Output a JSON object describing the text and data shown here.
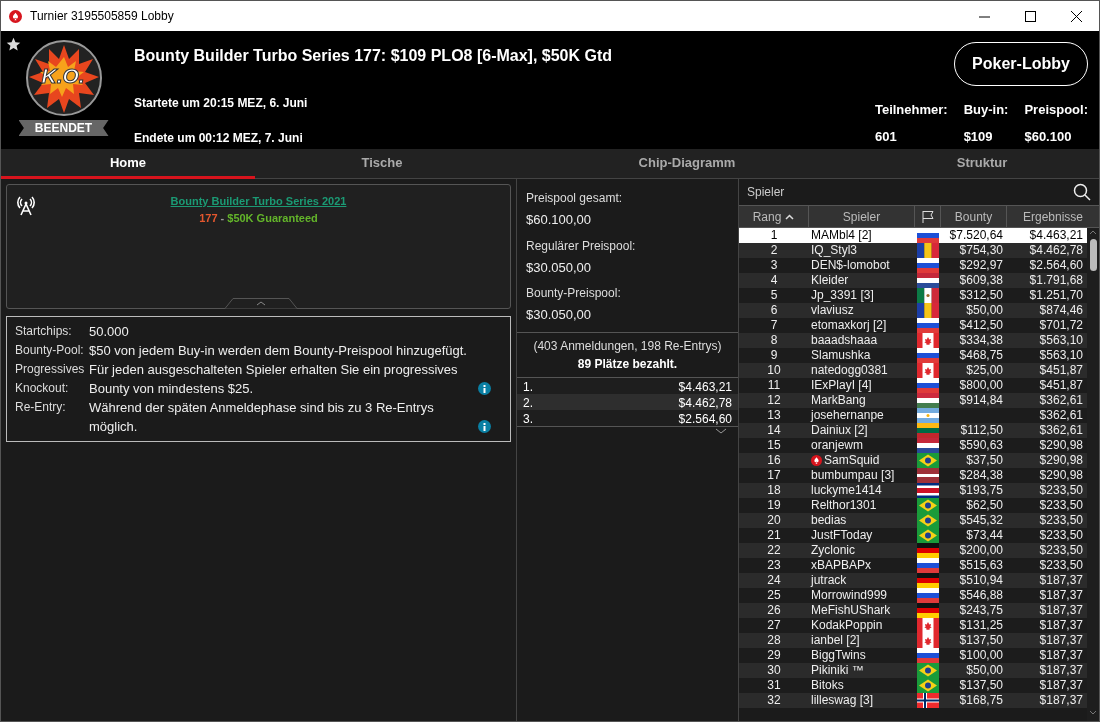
{
  "window": {
    "title": "Turnier 3195505859 Lobby"
  },
  "header": {
    "badge_text": "K.O.",
    "status": "BEENDET",
    "title": "Bounty Builder Turbo Series 177: $109 PLO8 [6-Max], $50K Gtd",
    "started": "Startete um 20:15 MEZ, 6. Juni",
    "ended": "Endete um 00:12 MEZ, 7. Juni",
    "lobby_button": "Poker-Lobby",
    "stats": [
      {
        "label": "Teilnehmer:",
        "value": "601"
      },
      {
        "label": "Buy-in:",
        "value": "$109"
      },
      {
        "label": "Preispool:",
        "value": "$60.100"
      }
    ]
  },
  "tabs": [
    {
      "label": "Home",
      "selected": true
    },
    {
      "label": "Tische",
      "selected": false
    },
    {
      "label": "Chip-Diagramm",
      "selected": false
    },
    {
      "label": "Struktur",
      "selected": false
    }
  ],
  "banner": {
    "link": "Bounty Builder Turbo Series 2021",
    "number": "177",
    "separator": "-",
    "guarantee": "$50K Guaranteed"
  },
  "details": [
    {
      "label": "Startchips:",
      "value": "50.000",
      "info": false
    },
    {
      "label": "Bounty-Pool:",
      "value": "$50 von jedem Buy-in werden dem Bounty-Preispool hinzugefügt.",
      "info": false
    },
    {
      "label": "Progressives Knockout:",
      "value": "Für jeden ausgeschalteten Spieler erhalten Sie ein progressives Bounty von mindestens $25.",
      "info": true
    },
    {
      "label": "Re-Entry:",
      "value": "Während der späten Anmeldephase sind bis zu 3 Re-Entrys möglich.",
      "info": true
    }
  ],
  "prizepool": [
    {
      "label": "Preispool gesamt:",
      "value": "$60.100,00"
    },
    {
      "label": "Regulärer Preispool:",
      "value": "$30.050,00"
    },
    {
      "label": "Bounty-Preispool:",
      "value": "$30.050,00"
    }
  ],
  "entries_note": "(403 Anmeldungen, 198 Re-Entrys)",
  "paid_note": "89 Plätze bezahlt.",
  "payouts": [
    {
      "place": "1.",
      "amount": "$4.463,21"
    },
    {
      "place": "2.",
      "amount": "$4.462,78"
    },
    {
      "place": "3.",
      "amount": "$2.564,60"
    }
  ],
  "players": {
    "search_placeholder": "Spieler",
    "columns": [
      "Rang",
      "Spieler",
      "Bounty",
      "Ergebnisse"
    ],
    "rows": [
      {
        "rank": "1",
        "name": "MAMbl4 [2]",
        "kind": "ru",
        "bounty": "$7.520,64",
        "result": "$4.463,21",
        "selected": true,
        "pro": false
      },
      {
        "rank": "2",
        "name": "IQ_Styl3",
        "kind": "ro",
        "bounty": "$754,30",
        "result": "$4.462,78",
        "selected": false,
        "pro": false
      },
      {
        "rank": "3",
        "name": "DEN$-lomobot",
        "kind": "ru",
        "bounty": "$292,97",
        "result": "$2.564,60",
        "selected": false,
        "pro": false
      },
      {
        "rank": "4",
        "name": "Kleider",
        "kind": "nl",
        "bounty": "$609,38",
        "result": "$1.791,68",
        "selected": false,
        "pro": false
      },
      {
        "rank": "5",
        "name": "Jp_3391 [3]",
        "kind": "mx",
        "bounty": "$312,50",
        "result": "$1.251,70",
        "selected": false,
        "pro": false
      },
      {
        "rank": "6",
        "name": "vlaviusz",
        "kind": "ro",
        "bounty": "$50,00",
        "result": "$874,46",
        "selected": false,
        "pro": false
      },
      {
        "rank": "7",
        "name": "etomaxkorj [2]",
        "kind": "ru",
        "bounty": "$412,50",
        "result": "$701,72",
        "selected": false,
        "pro": false
      },
      {
        "rank": "8",
        "name": "baaadshaaa",
        "kind": "ca",
        "bounty": "$334,38",
        "result": "$563,10",
        "selected": false,
        "pro": false
      },
      {
        "rank": "9",
        "name": "Slamushka",
        "kind": "ru",
        "bounty": "$468,75",
        "result": "$563,10",
        "selected": false,
        "pro": false
      },
      {
        "rank": "10",
        "name": "natedogg0381",
        "kind": "ca",
        "bounty": "$25,00",
        "result": "$451,87",
        "selected": false,
        "pro": false
      },
      {
        "rank": "11",
        "name": "IExPlayI [4]",
        "kind": "ru",
        "bounty": "$800,00",
        "result": "$451,87",
        "selected": false,
        "pro": false
      },
      {
        "rank": "12",
        "name": "MarkBang",
        "kind": "hu",
        "bounty": "$914,84",
        "result": "$362,61",
        "selected": false,
        "pro": false
      },
      {
        "rank": "13",
        "name": "josehernanpe",
        "kind": "ar",
        "result": "$362,61",
        "selected": false,
        "pro": false
      },
      {
        "rank": "14",
        "name": "Dainiux [2]",
        "kind": "lt",
        "bounty": "$112,50",
        "result": "$362,61",
        "selected": false,
        "pro": false
      },
      {
        "rank": "15",
        "name": "oranjewm",
        "kind": "nl",
        "bounty": "$590,63",
        "result": "$290,98",
        "selected": false,
        "pro": false
      },
      {
        "rank": "16",
        "name": "SamSquid",
        "kind": "br",
        "bounty": "$37,50",
        "result": "$290,98",
        "selected": false,
        "pro": true
      },
      {
        "rank": "17",
        "name": "bumbumpau [3]",
        "kind": "lv",
        "bounty": "$284,38",
        "result": "$290,98",
        "selected": false,
        "pro": false
      },
      {
        "rank": "18",
        "name": "luckyme1414",
        "kind": "cr",
        "bounty": "$193,75",
        "result": "$233,50",
        "selected": false,
        "pro": false
      },
      {
        "rank": "19",
        "name": "Relthor1301",
        "kind": "br",
        "bounty": "$62,50",
        "result": "$233,50",
        "selected": false,
        "pro": false
      },
      {
        "rank": "20",
        "name": "bedias",
        "kind": "br",
        "bounty": "$545,32",
        "result": "$233,50",
        "selected": false,
        "pro": false
      },
      {
        "rank": "21",
        "name": "JustFToday",
        "kind": "br",
        "bounty": "$73,44",
        "result": "$233,50",
        "selected": false,
        "pro": false
      },
      {
        "rank": "22",
        "name": "Zyclonic",
        "kind": "de",
        "bounty": "$200,00",
        "result": "$233,50",
        "selected": false,
        "pro": false
      },
      {
        "rank": "23",
        "name": "xBAPBAPx",
        "kind": "ru",
        "bounty": "$515,63",
        "result": "$233,50",
        "selected": false,
        "pro": false
      },
      {
        "rank": "24",
        "name": "jutrack",
        "kind": "de",
        "bounty": "$510,94",
        "result": "$187,37",
        "selected": false,
        "pro": false
      },
      {
        "rank": "25",
        "name": "Morrowind999",
        "kind": "ru",
        "bounty": "$546,88",
        "result": "$187,37",
        "selected": false,
        "pro": false
      },
      {
        "rank": "26",
        "name": "MeFishUShark",
        "kind": "de",
        "bounty": "$243,75",
        "result": "$187,37",
        "selected": false,
        "pro": false
      },
      {
        "rank": "27",
        "name": "KodakPoppin",
        "kind": "ca",
        "bounty": "$131,25",
        "result": "$187,37",
        "selected": false,
        "pro": false
      },
      {
        "rank": "28",
        "name": "ianbel [2]",
        "kind": "ca",
        "bounty": "$137,50",
        "result": "$187,37",
        "selected": false,
        "pro": false
      },
      {
        "rank": "29",
        "name": "BiggTwins",
        "kind": "ru",
        "bounty": "$100,00",
        "result": "$187,37",
        "selected": false,
        "pro": false
      },
      {
        "rank": "30",
        "name": "Pikiniki ™",
        "kind": "br",
        "bounty": "$50,00",
        "result": "$187,37",
        "selected": false,
        "pro": false
      },
      {
        "rank": "31",
        "name": "Bitoks",
        "kind": "br",
        "bounty": "$137,50",
        "result": "$187,37",
        "selected": false,
        "pro": false
      },
      {
        "rank": "32",
        "name": "lilleswag [3]",
        "kind": "no",
        "bounty": "$168,75",
        "result": "$187,37",
        "selected": false,
        "pro": false
      }
    ]
  }
}
